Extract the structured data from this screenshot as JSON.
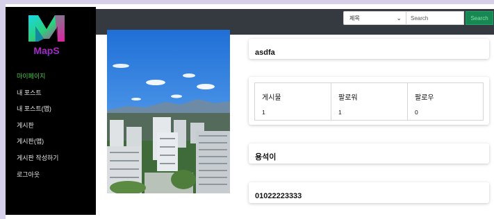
{
  "brand": {
    "name": "MapS"
  },
  "sidebar": {
    "items": [
      {
        "label": "마이페이지",
        "active": true
      },
      {
        "label": "내 포스트"
      },
      {
        "label": "내 포스트(맵)"
      },
      {
        "label": "게시판"
      },
      {
        "label": "게시판(맵)"
      },
      {
        "label": "게시판 작성하기"
      },
      {
        "label": "로그아웃"
      }
    ]
  },
  "search": {
    "select_value": "제목",
    "placeholder": "Search",
    "button_label": "Search"
  },
  "profile": {
    "username": "asdfa",
    "stats": [
      {
        "label": "게시물",
        "value": "1"
      },
      {
        "label": "팔로워",
        "value": "1"
      },
      {
        "label": "팔로우",
        "value": "0"
      }
    ],
    "nickname": "용석이",
    "phone": "01022223333"
  },
  "colors": {
    "topbar": "#343a40",
    "sidebar": "#000000",
    "active_nav": "#4cc94a",
    "search_button": "#198754"
  },
  "icons": {
    "select_chevron": "chevron-down-icon"
  }
}
